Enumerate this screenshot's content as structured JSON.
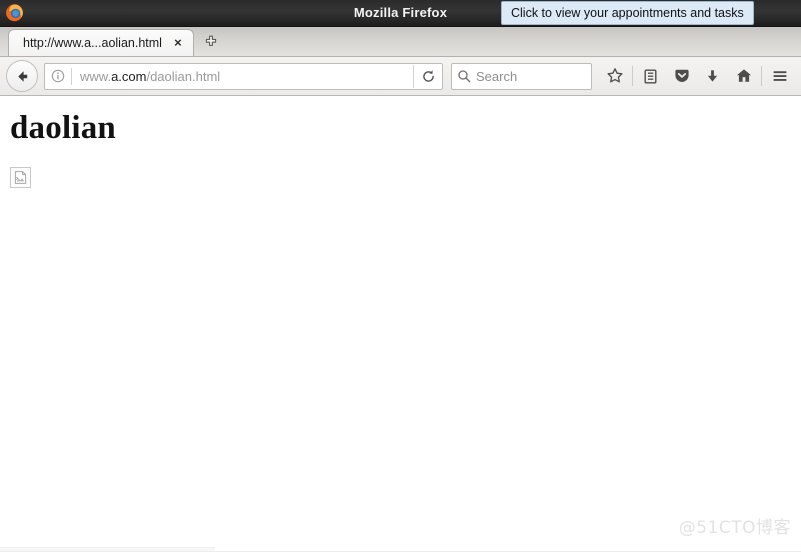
{
  "window": {
    "title": "Mozilla Firefox",
    "logo_icon": "firefox-logo-icon"
  },
  "tooltip": {
    "text": "Click to view your appointments and tasks",
    "background": "#dce9f7",
    "border": "#9fb6cd"
  },
  "tabstrip": {
    "tabs": [
      {
        "label": "http://www.a...aolian.html",
        "close_label": "×"
      }
    ],
    "new_tab_icon": "plus-icon",
    "new_tab_label": "+"
  },
  "navbar": {
    "back_icon": "back-arrow-icon",
    "identity_icon": "info-icon",
    "url": {
      "prefix": "www.",
      "host": "a.com",
      "path": "/daolian.html",
      "full": "www.a.com/daolian.html"
    },
    "reload_icon": "reload-icon",
    "search": {
      "icon": "search-icon",
      "placeholder": "Search",
      "value": ""
    },
    "buttons": [
      {
        "name": "bookmark-star-button",
        "icon": "star-icon"
      },
      {
        "name": "library-button",
        "icon": "library-icon"
      },
      {
        "name": "pocket-button",
        "icon": "pocket-icon"
      },
      {
        "name": "downloads-button",
        "icon": "download-arrow-icon"
      },
      {
        "name": "home-button",
        "icon": "home-icon"
      },
      {
        "name": "menu-button",
        "icon": "hamburger-menu-icon"
      }
    ]
  },
  "page": {
    "heading": "daolian",
    "broken_image_alt": "",
    "broken_image_icon": "broken-image-icon",
    "watermark": "@51CTO博客"
  }
}
